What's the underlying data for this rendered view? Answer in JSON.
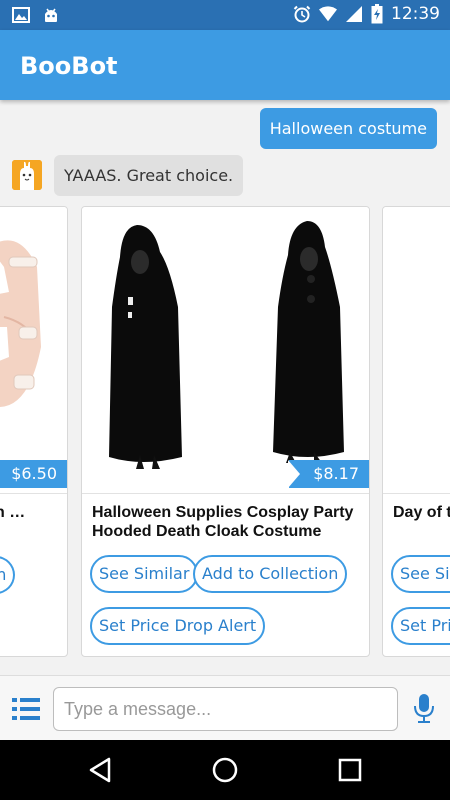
{
  "status_bar": {
    "time": "12:39",
    "left_icons": [
      "image-icon",
      "android-icon"
    ],
    "right_icons": [
      "alarm-icon",
      "wifi-icon",
      "signal-icon",
      "battery-icon"
    ]
  },
  "app": {
    "title": "BooBot"
  },
  "chat": {
    "user_message": "Halloween costume",
    "bot_message": "YAAAS. Great choice."
  },
  "cards": [
    {
      "title": "…oween …",
      "price": "$6.50",
      "buttons": [
        "…ion"
      ]
    },
    {
      "title": "Halloween Supplies Cosplay Party Hooded Death Cloak Costume",
      "price": "$8.17",
      "buttons": [
        "See Similar",
        "Add to Collection",
        "Set Price Drop Alert"
      ]
    },
    {
      "title": "Day of t… Adult Co…",
      "price": "",
      "buttons": [
        "See Sim…",
        "Set Pric…"
      ]
    }
  ],
  "input": {
    "placeholder": "Type a message..."
  },
  "colors": {
    "primary": "#3d9be3",
    "status_bar": "#2a70b3",
    "bot_bubble": "#e0e0e0"
  }
}
